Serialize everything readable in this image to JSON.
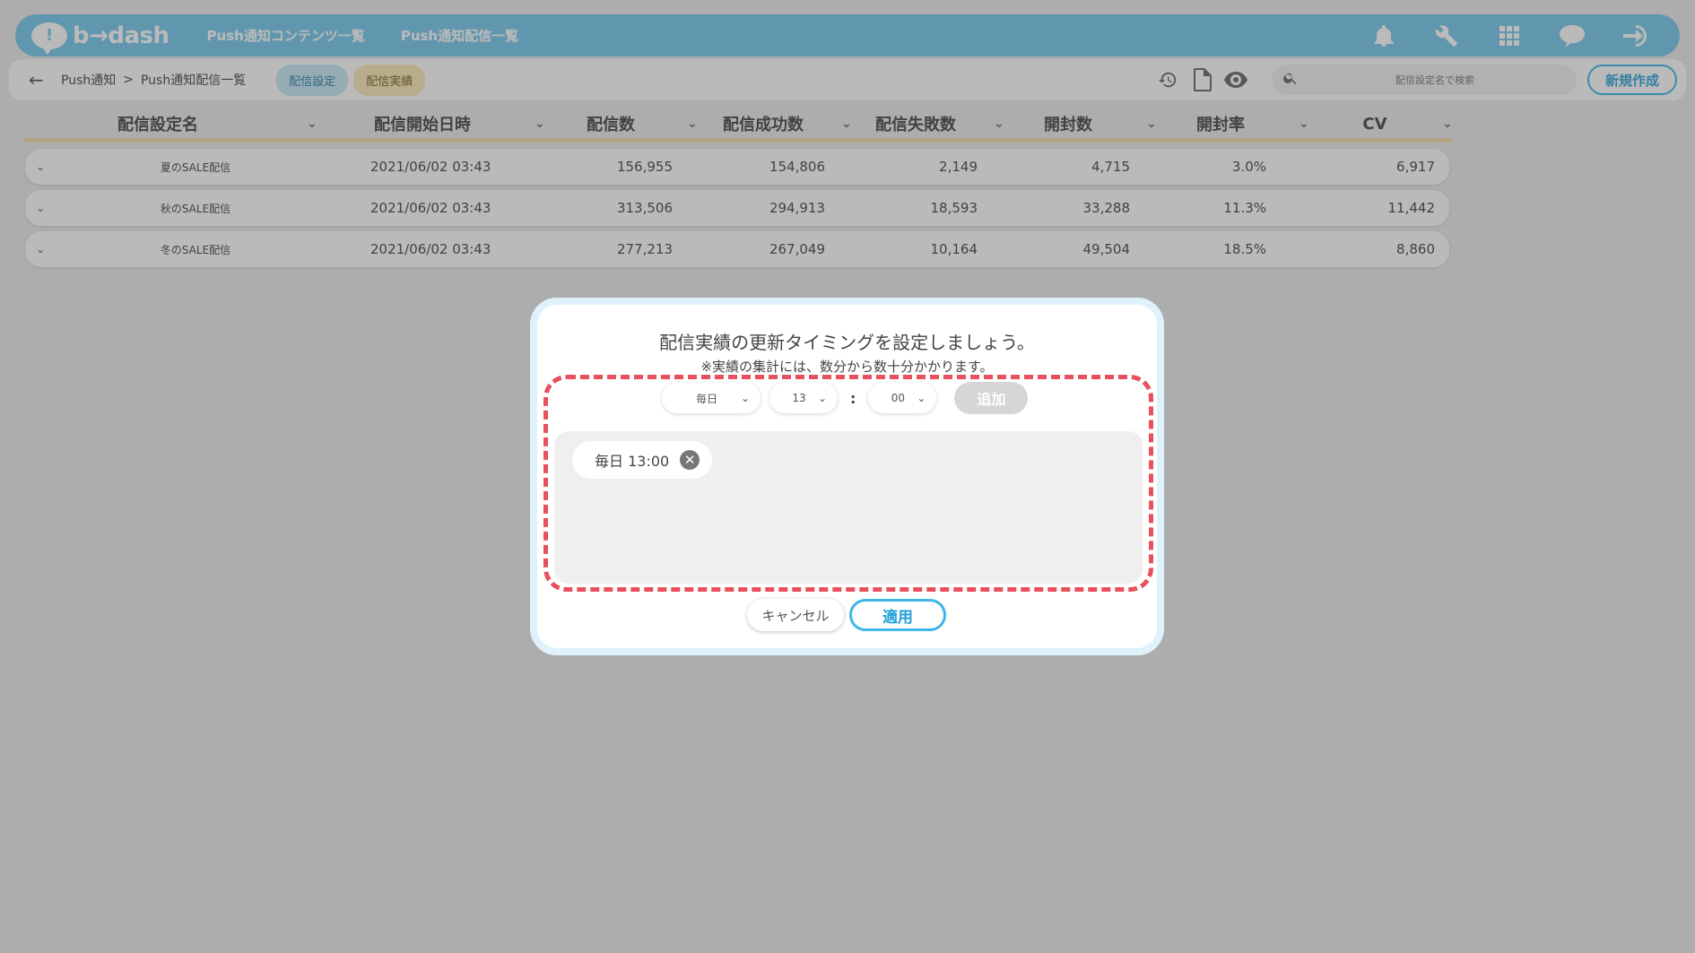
{
  "header": {
    "logo_text": "b→dash",
    "logo_mark": "!",
    "nav": [
      "Push通知コンテンツ一覧",
      "Push通知配信一覧"
    ],
    "icons": [
      "bell-icon",
      "wrench-icon",
      "apps-grid-icon",
      "chat-bubble-icon",
      "logout-icon"
    ],
    "color_bar": "#75c9ec"
  },
  "subbar": {
    "back_icon": "←",
    "breadcrumb": [
      "Push通知",
      "Push通知配信一覧"
    ],
    "breadcrumb_sep": ">",
    "tabs": [
      "配信設定",
      "配信実績"
    ],
    "icons": [
      "history-icon",
      "clipboard-icon",
      "eye-icon"
    ],
    "search_placeholder": "配信設定名で検索",
    "new_button": "新規作成"
  },
  "table": {
    "columns": [
      "配信設定名",
      "配信開始日時",
      "配信数",
      "配信成功数",
      "配信失敗数",
      "開封数",
      "開封率",
      "CV"
    ],
    "sort_icon": "⌄",
    "rows": [
      [
        "夏のSALE配信",
        "2021/06/02 03:43",
        "156,955",
        "154,806",
        "2,149",
        "4,715",
        "3.0%",
        "6,917"
      ],
      [
        "秋のSALE配信",
        "2021/06/02 03:43",
        "313,506",
        "294,913",
        "18,593",
        "33,288",
        "11.3%",
        "11,442"
      ],
      [
        "冬のSALE配信",
        "2021/06/02 03:43",
        "277,213",
        "267,049",
        "10,164",
        "49,504",
        "18.5%",
        "8,860"
      ]
    ]
  },
  "modal": {
    "title": "配信実績の更新タイミングを設定しましょう。",
    "subtitle": "※実績の集計には、数分から数十分かかります。",
    "frequency": "毎日",
    "hour": "13",
    "colon": ":",
    "minute": "00",
    "add_label": "追加",
    "chips": [
      "毎日 13:00"
    ],
    "chip_remove": "✕",
    "cancel_label": "キャンセル",
    "apply_label": "適用",
    "highlight_color": "#e9505e"
  }
}
